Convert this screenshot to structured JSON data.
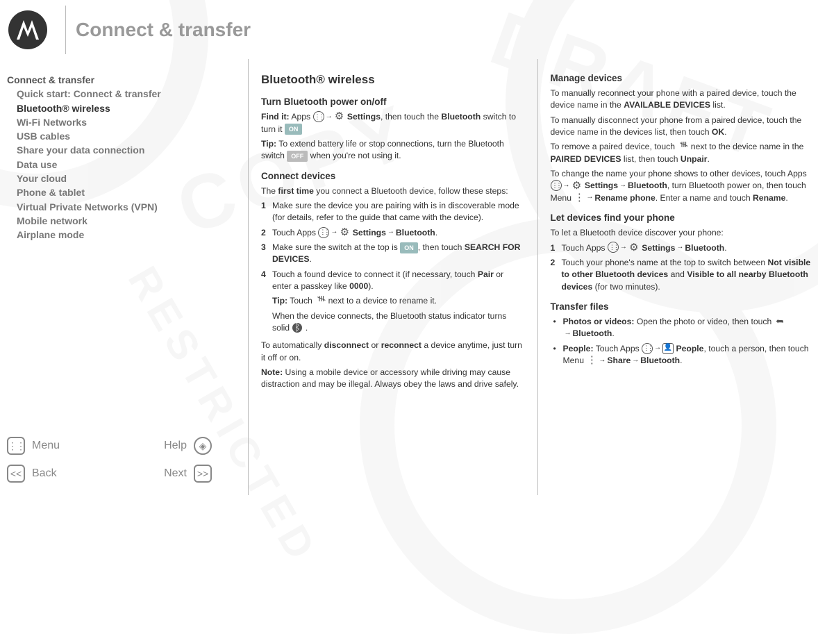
{
  "header": {
    "title": "Connect & transfer"
  },
  "toc": {
    "head": "Connect & transfer",
    "items": [
      "Quick start: Connect & transfer",
      "Bluetooth® wireless",
      "Wi-Fi Networks",
      "USB cables",
      "Share your data connection",
      "Data use",
      "Your cloud",
      "Phone & tablet",
      "Virtual Private Networks (VPN)",
      "Mobile network",
      "Airplane mode"
    ]
  },
  "nav": {
    "menu": "Menu",
    "help": "Help",
    "back": "Back",
    "next": "Next"
  },
  "pill": {
    "on": "ON",
    "off": "OFF"
  },
  "col1": {
    "h2": "Bluetooth® wireless",
    "h3a": "Turn Bluetooth power on/off",
    "find_label": "Find it:",
    "find_a": " Apps ",
    "find_b": "Settings",
    "find_c": ", then touch the ",
    "find_d": "Bluetooth",
    "find_e": " switch to turn it ",
    "tip1_label": "Tip:",
    "tip1_a": " To extend battery life or stop connections, turn the Bluetooth switch ",
    "tip1_b": " when you're not using it.",
    "h3b": "Connect devices",
    "p_first_a": "The ",
    "p_first_b": "first time",
    "p_first_c": " you connect a Bluetooth device, follow these steps:",
    "s1": "Make sure the device you are pairing with is in discoverable mode (for details, refer to the guide that came with the device).",
    "s2_a": "Touch Apps ",
    "s2_b": "Settings",
    "s2_c": "Bluetooth",
    "s3_a": "Make sure the switch at the top is ",
    "s3_b": ", then touch ",
    "s3_c": "SEARCH FOR DEVICES",
    "s4_a": "Touch a found device to connect it (if necessary, touch ",
    "s4_b": "Pair",
    "s4_c": " or enter a passkey like ",
    "s4_d": "0000",
    "s4_e": ").",
    "s4_tip_label": "Tip:",
    "s4_tip_a": " Touch ",
    "s4_tip_b": " next to a device to rename it.",
    "s4_sub2_a": "When the device connects, the Bluetooth status indicator turns solid ",
    "p_auto_a": "To automatically ",
    "p_auto_b": "disconnect",
    "p_auto_c": " or ",
    "p_auto_d": "reconnect",
    "p_auto_e": " a device anytime, just turn it off or on.",
    "note_label": "Note:",
    "note_a": " Using a mobile device or accessory while driving may cause distraction and may be illegal. Always obey the laws and drive safely."
  },
  "col2": {
    "h3a": "Manage devices",
    "p1_a": "To manually reconnect your phone with a paired device, touch the device name in the ",
    "p1_b": "AVAILABLE DEVICES",
    "p1_c": " list.",
    "p2_a": "To manually disconnect your phone from a paired device, touch the device name in the devices list, then touch ",
    "p2_b": "OK",
    "p3_a": "To remove a paired device, touch ",
    "p3_b": " next to the device name in the ",
    "p3_c": "PAIRED DEVICES",
    "p3_d": " list, then touch ",
    "p3_e": "Unpair",
    "p4_a": "To change the name your phone shows to other devices, touch Apps ",
    "p4_b": "Settings",
    "p4_c": "Bluetooth",
    "p4_d": ", turn Bluetooth power on, then touch Menu ",
    "p4_e": "Rename phone",
    "p4_f": ". Enter a name and touch ",
    "p4_g": "Rename",
    "h3b": "Let devices find your phone",
    "p5": "To let a Bluetooth device discover your phone:",
    "s1_a": "Touch Apps ",
    "s1_b": "Settings",
    "s1_c": "Bluetooth",
    "s2_a": "Touch your phone's name at the top to switch between ",
    "s2_b": "Not visible to other Bluetooth devices",
    "s2_c": " and ",
    "s2_d": "Visible to all nearby Bluetooth devices",
    "s2_e": " (for two minutes).",
    "h3c": "Transfer files",
    "b1_label": "Photos or videos:",
    "b1_a": " Open the photo or video, then touch ",
    "b1_b": "Bluetooth",
    "b2_label": "People:",
    "b2_a": " Touch Apps ",
    "b2_b": "People",
    "b2_c": ", touch a person, then touch Menu ",
    "b2_d": "Share",
    "b2_e": "Bluetooth"
  }
}
